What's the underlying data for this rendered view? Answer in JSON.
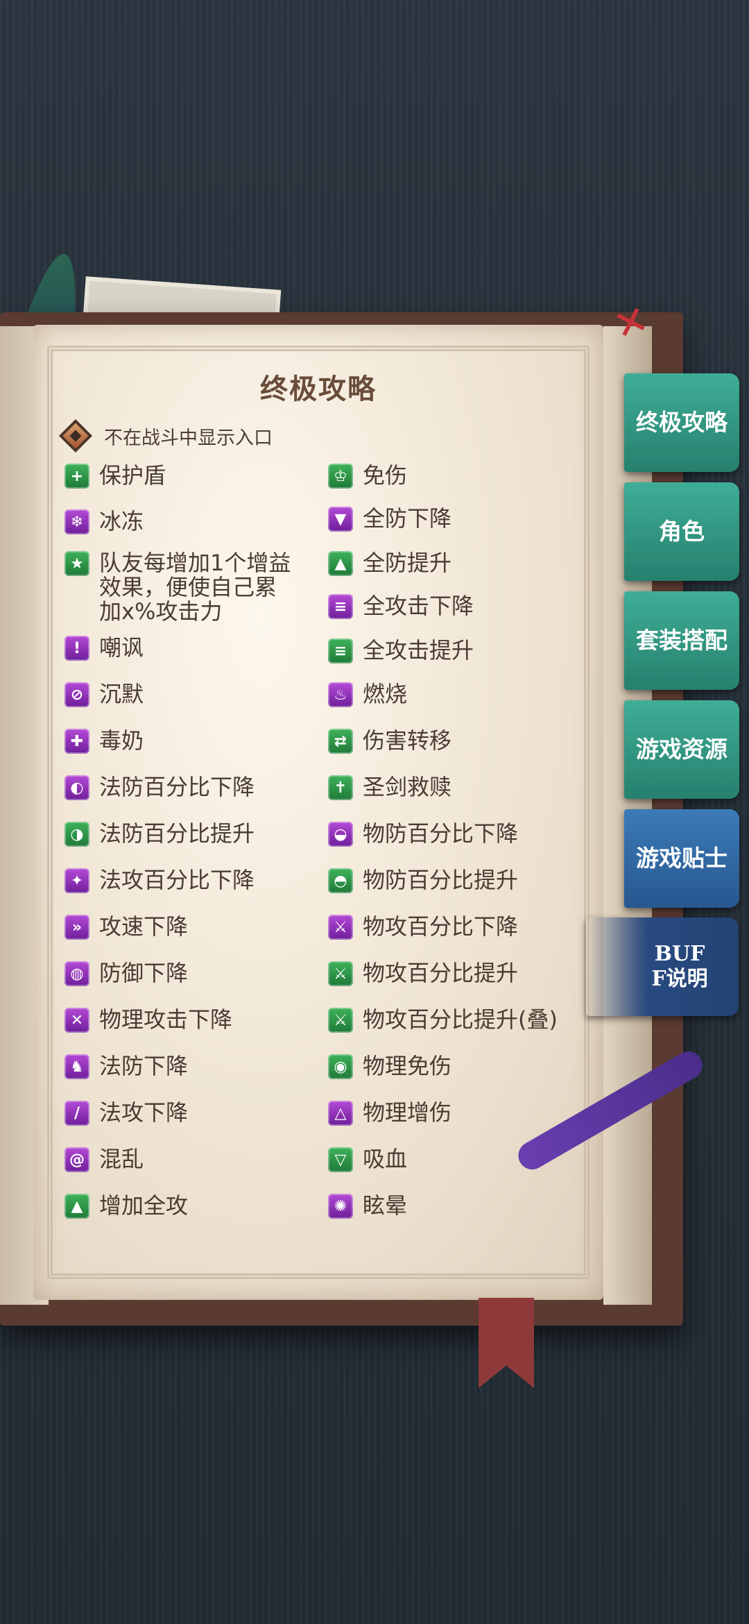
{
  "title": "终极攻略",
  "toggle": {
    "label": "不在战斗中显示入口"
  },
  "buffs_left": [
    {
      "label": "保护盾",
      "icon": "shield-plus-icon",
      "color": "green"
    },
    {
      "label": "冰冻",
      "icon": "snowflake-icon",
      "color": "purple"
    },
    {
      "label": "队友每增加1个增益效果，便使自己累加x%攻击力",
      "icon": "star-sword-icon",
      "color": "green"
    },
    {
      "label": "嘲讽",
      "icon": "taunt-icon",
      "color": "purple"
    },
    {
      "label": "沉默",
      "icon": "silence-icon",
      "color": "purple"
    },
    {
      "label": "毒奶",
      "icon": "poison-cross-icon",
      "color": "purple"
    },
    {
      "label": "法防百分比下降",
      "icon": "magic-defense-down-icon",
      "color": "purple"
    },
    {
      "label": "法防百分比提升",
      "icon": "magic-defense-up-icon",
      "color": "green"
    },
    {
      "label": "法攻百分比下降",
      "icon": "magic-attack-down-icon",
      "color": "purple"
    },
    {
      "label": "攻速下降",
      "icon": "attack-speed-down-icon",
      "color": "purple"
    },
    {
      "label": "防御下降",
      "icon": "defense-down-icon",
      "color": "purple"
    },
    {
      "label": "物理攻击下降",
      "icon": "crossed-swords-icon",
      "color": "purple"
    },
    {
      "label": "法防下降",
      "icon": "magic-defense-icon",
      "color": "purple"
    },
    {
      "label": "法攻下降",
      "icon": "magic-staff-icon",
      "color": "purple"
    },
    {
      "label": "混乱",
      "icon": "spiral-icon",
      "color": "purple"
    },
    {
      "label": "增加全攻",
      "icon": "shield-up-icon",
      "color": "green"
    }
  ],
  "buffs_right": [
    {
      "label": "免伤",
      "icon": "damage-immune-icon",
      "color": "green"
    },
    {
      "label": "全防下降",
      "icon": "all-defense-down-icon",
      "color": "purple"
    },
    {
      "label": "全防提升",
      "icon": "all-defense-up-icon",
      "color": "green"
    },
    {
      "label": "全攻击下降",
      "icon": "all-attack-down-icon",
      "color": "purple"
    },
    {
      "label": "全攻击提升",
      "icon": "all-attack-up-icon",
      "color": "green"
    },
    {
      "label": "燃烧",
      "icon": "flame-icon",
      "color": "purple"
    },
    {
      "label": "伤害转移",
      "icon": "damage-transfer-icon",
      "color": "green"
    },
    {
      "label": "圣剑救赎",
      "icon": "holy-sword-icon",
      "color": "green"
    },
    {
      "label": "物防百分比下降",
      "icon": "physical-defense-down-icon",
      "color": "purple"
    },
    {
      "label": "物防百分比提升",
      "icon": "physical-defense-up-icon",
      "color": "green"
    },
    {
      "label": "物攻百分比下降",
      "icon": "physical-attack-down-icon",
      "color": "purple"
    },
    {
      "label": "物攻百分比提升",
      "icon": "physical-attack-up-icon",
      "color": "green"
    },
    {
      "label": "物攻百分比提升(叠)",
      "icon": "physical-attack-stack-icon",
      "color": "green"
    },
    {
      "label": "物理免伤",
      "icon": "physical-immune-icon",
      "color": "green"
    },
    {
      "label": "物理增伤",
      "icon": "physical-damage-up-icon",
      "color": "purple"
    },
    {
      "label": "吸血",
      "icon": "vampire-fang-icon",
      "color": "green"
    },
    {
      "label": "眩晕",
      "icon": "stun-icon",
      "color": "purple"
    }
  ],
  "tabs": [
    {
      "label": "终极攻略",
      "color": "#3fae96"
    },
    {
      "label": "角色",
      "color": "#3fae96"
    },
    {
      "label": "套装搭配",
      "color": "#3fae96"
    },
    {
      "label": "游戏资源",
      "color": "#3fae96"
    },
    {
      "label": "游戏贴士",
      "color": "#3c7bb8"
    },
    {
      "label": "BUFF说明",
      "color": "#284a80",
      "active": true
    }
  ]
}
